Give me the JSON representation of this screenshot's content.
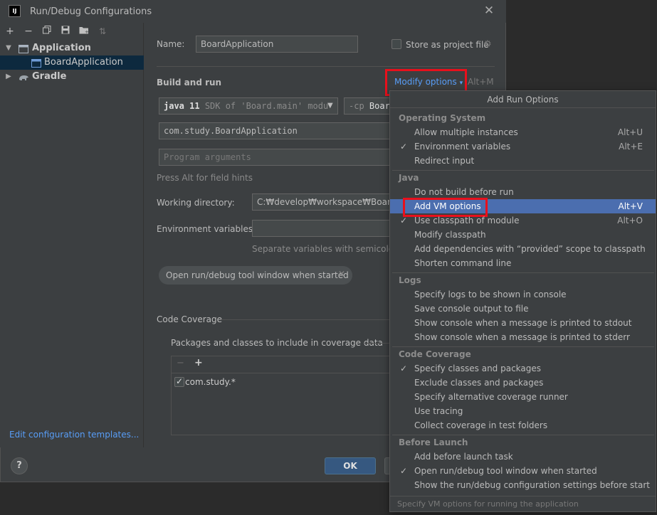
{
  "window": {
    "title": "Run/Debug Configurations",
    "app_icon": "IJ"
  },
  "sidebar": {
    "toolbar_icons": [
      "add-icon",
      "remove-icon",
      "copy-icon",
      "save-icon",
      "folder-icon",
      "sort-icon"
    ],
    "tree": [
      {
        "label": "Application",
        "expanded": true
      },
      {
        "label": "BoardApplication",
        "selected": true
      },
      {
        "label": "Gradle",
        "expanded": false
      }
    ],
    "edit_templates": "Edit configuration templates..."
  },
  "form": {
    "name_label": "Name:",
    "name_value": "BoardApplication",
    "store_label": "Store as project file",
    "build_run_title": "Build and run",
    "modify_options": "Modify options",
    "modify_shortcut": "Alt+M",
    "jdk_value": "java 11",
    "jdk_hint": "SDK of 'Board.main' modu",
    "classpath_prefix": "-cp",
    "classpath_value": "Boar",
    "main_class": "com.study.BoardApplication",
    "program_args_placeholder": "Program arguments",
    "field_hint": "Press Alt for field hints",
    "working_dir_label": "Working directory:",
    "working_dir_value": "C:₩develop₩workspace₩Board",
    "env_label": "Environment variables:",
    "env_hint": "Separate variables with semicolon: V",
    "tag_label": "Open run/debug tool window when started",
    "coverage_title": "Code Coverage",
    "coverage_packages_label": "Packages and classes to include in coverage data",
    "coverage_entry": "com.study.*"
  },
  "buttons": {
    "help": "?",
    "ok": "OK"
  },
  "popup": {
    "title": "Add Run Options",
    "groups": [
      {
        "title": "Operating System",
        "items": [
          {
            "label": "Allow multiple instances",
            "shortcut": "Alt+U",
            "checked": false
          },
          {
            "label": "Environment variables",
            "shortcut": "Alt+E",
            "checked": true
          },
          {
            "label": "Redirect input",
            "shortcut": "",
            "checked": false
          }
        ]
      },
      {
        "title": "Java",
        "items": [
          {
            "label": "Do not build before run",
            "shortcut": "",
            "checked": false
          },
          {
            "label": "Add VM options",
            "shortcut": "Alt+V",
            "checked": false,
            "selected": true
          },
          {
            "label": "Use classpath of module",
            "shortcut": "Alt+O",
            "checked": true
          },
          {
            "label": "Modify classpath",
            "shortcut": "",
            "checked": false
          },
          {
            "label": "Add dependencies with “provided” scope to classpath",
            "shortcut": "",
            "checked": false
          },
          {
            "label": "Shorten command line",
            "shortcut": "",
            "checked": false
          }
        ]
      },
      {
        "title": "Logs",
        "items": [
          {
            "label": "Specify logs to be shown in console",
            "shortcut": "",
            "checked": false
          },
          {
            "label": "Save console output to file",
            "shortcut": "",
            "checked": false
          },
          {
            "label": "Show console when a message is printed to stdout",
            "shortcut": "",
            "checked": false
          },
          {
            "label": "Show console when a message is printed to stderr",
            "shortcut": "",
            "checked": false
          }
        ]
      },
      {
        "title": "Code Coverage",
        "items": [
          {
            "label": "Specify classes and packages",
            "shortcut": "",
            "checked": true
          },
          {
            "label": "Exclude classes and packages",
            "shortcut": "",
            "checked": false
          },
          {
            "label": "Specify alternative coverage runner",
            "shortcut": "",
            "checked": false
          },
          {
            "label": "Use tracing",
            "shortcut": "",
            "checked": false
          },
          {
            "label": "Collect coverage in test folders",
            "shortcut": "",
            "checked": false
          }
        ]
      },
      {
        "title": "Before Launch",
        "items": [
          {
            "label": "Add before launch task",
            "shortcut": "",
            "checked": false
          },
          {
            "label": "Open run/debug tool window when started",
            "shortcut": "",
            "checked": true
          },
          {
            "label": "Show the run/debug configuration settings before start",
            "shortcut": "",
            "checked": false
          }
        ]
      }
    ],
    "footer": "Specify VM options for running the application"
  },
  "colors": {
    "accent_link": "#589df6",
    "selection": "#4b6eaf",
    "highlight_box": "#e8101c"
  }
}
